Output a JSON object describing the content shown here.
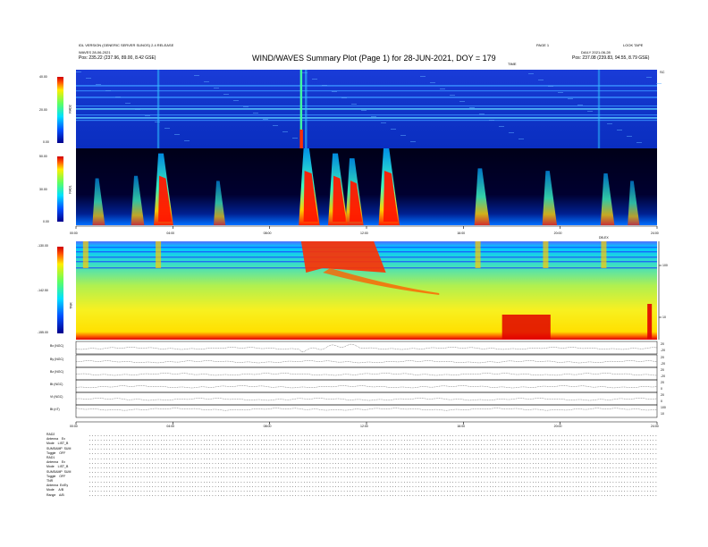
{
  "header": {
    "left_line1": "IDL VERSION (GENERIC SERVER SUNOS) 2.4 RELEASE",
    "left_line2": "WAVES 28-06-2021",
    "left_line3_label": "Pos:",
    "left_line3_value": "235.22 (237.96, 89.00, 8.42 GSE)",
    "right_line1_a": "PAGE 1",
    "right_line1_b": "LOOK TAPE",
    "right_line2": "DAILY 2021-06-28",
    "right_line3_label": "Pos:",
    "right_line3_value": "237.08 (239.83, 94.55, 8.79 GSE)",
    "title": "WIND/WAVES Summary Plot (Page 1) for 28-JUN-2021, DOY = 179",
    "mid_right_a": "TIME",
    "mid_right_b": "SC"
  },
  "panels": {
    "rad2": {
      "label": "RAD2",
      "ticks": [
        "40.00",
        "20.00",
        "0.00"
      ]
    },
    "rad1": {
      "label": "RAD1",
      "ticks": [
        "50.00",
        "30.00",
        "0.00"
      ]
    },
    "tnr": {
      "label": "TNR",
      "ticks": [
        "-130.00",
        "-142.50",
        "-155.00"
      ],
      "right_ticks": [
        "100",
        "10"
      ],
      "right_top": "DB-EX"
    },
    "xticks_upper": [
      "00:00",
      "04:00",
      "08:00",
      "12:00",
      "16:00",
      "20:00",
      "24:00"
    ],
    "xticks_lower": [
      "00:00",
      "04:00",
      "08:00",
      "12:00",
      "16:00",
      "20:00",
      "24:00"
    ],
    "strips": [
      {
        "label": "Bx (NGC)",
        "r1": "20",
        "r2": "-20"
      },
      {
        "label": "By (NGC)",
        "r1": "20",
        "r2": "-20"
      },
      {
        "label": "Bz (NGC)",
        "r1": "20",
        "r2": "-20"
      },
      {
        "label": "Bt (NGC)",
        "r1": "20",
        "r2": "0"
      },
      {
        "label": "Vt (NGC)",
        "r1": "20",
        "r2": "0"
      },
      {
        "label": "Bt (nT)",
        "r1": "100",
        "r2": "10"
      }
    ]
  },
  "params": {
    "rad2_block": "RAD2\nAntenna    Ex\nMode    LIST_B\nSUMSAMP  SUM\nToggle    OFF",
    "rad1_block": "RAD1\nAntenna    Ex\nMode    LIST_B\nSUMSAMP  SUM\nToggle    OFF",
    "tnr_block": "TNR\nAntenna  Ex/Ey\nMode     A/B\nRange    A/B"
  },
  "chart_data": [
    {
      "type": "heatmap",
      "name": "RAD2",
      "ylabel": "RAD2",
      "yticks": [
        40,
        20,
        0
      ],
      "ylim": [
        0,
        40
      ],
      "xlim_hours": [
        0,
        24
      ],
      "colors": {
        "background": "#1a3cd8",
        "band": "#38a0ff"
      },
      "bursts_hours": [
        {
          "t": 3.4,
          "level": 0.55
        },
        {
          "t": 9.3,
          "level": 1.0
        },
        {
          "t": 9.5,
          "level": 0.6
        },
        {
          "t": 21.6,
          "level": 0.5
        }
      ]
    },
    {
      "type": "heatmap",
      "name": "RAD1",
      "ylabel": "RAD1",
      "yticks": [
        50,
        30,
        0
      ],
      "ylim": [
        0,
        50
      ],
      "xlim_hours": [
        0,
        24
      ],
      "bursts_hours": [
        {
          "t": 0.8,
          "level": 0.4
        },
        {
          "t": 2.4,
          "level": 0.45
        },
        {
          "t": 3.4,
          "level": 0.9
        },
        {
          "t": 5.8,
          "level": 0.35
        },
        {
          "t": 9.4,
          "level": 1.0
        },
        {
          "t": 10.6,
          "level": 0.9
        },
        {
          "t": 11.3,
          "level": 0.8
        },
        {
          "t": 12.7,
          "level": 1.0
        },
        {
          "t": 16.6,
          "level": 0.6
        },
        {
          "t": 19.4,
          "level": 0.55
        },
        {
          "t": 21.8,
          "level": 0.5
        },
        {
          "t": 22.9,
          "level": 0.35
        }
      ]
    },
    {
      "type": "heatmap",
      "name": "TNR",
      "ylabel": "TNR",
      "yticks": [
        -130.0,
        -142.5,
        -155.0
      ],
      "ylim": [
        -155.0,
        -130.0
      ],
      "right_axis_ticks": [
        100,
        10
      ],
      "xlim_hours": [
        0,
        24
      ]
    }
  ]
}
